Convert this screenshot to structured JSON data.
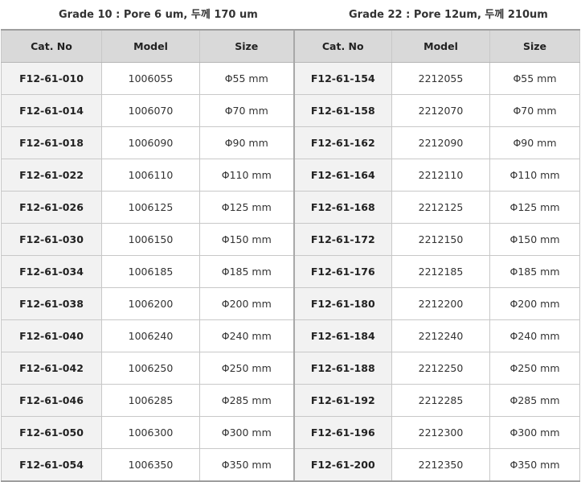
{
  "headings": {
    "left": "Grade 10 : Pore 6 um, 두께 170 um",
    "right": "Grade 22 : Pore 12um, 두께 210um"
  },
  "columns": {
    "cat_no": "Cat. No",
    "model": "Model",
    "size": "Size"
  },
  "rows": [
    {
      "left": {
        "cat": "F12-61-010",
        "model": "1006055",
        "size": "Φ55 mm"
      },
      "right": {
        "cat": "F12-61-154",
        "model": "2212055",
        "size": "Φ55 mm"
      }
    },
    {
      "left": {
        "cat": "F12-61-014",
        "model": "1006070",
        "size": "Φ70 mm"
      },
      "right": {
        "cat": "F12-61-158",
        "model": "2212070",
        "size": "Φ70 mm"
      }
    },
    {
      "left": {
        "cat": "F12-61-018",
        "model": "1006090",
        "size": "Φ90 mm"
      },
      "right": {
        "cat": "F12-61-162",
        "model": "2212090",
        "size": "Φ90 mm"
      }
    },
    {
      "left": {
        "cat": "F12-61-022",
        "model": "1006110",
        "size": "Φ110 mm"
      },
      "right": {
        "cat": "F12-61-164",
        "model": "2212110",
        "size": "Φ110 mm"
      }
    },
    {
      "left": {
        "cat": "F12-61-026",
        "model": "1006125",
        "size": "Φ125 mm"
      },
      "right": {
        "cat": "F12-61-168",
        "model": "2212125",
        "size": "Φ125 mm"
      }
    },
    {
      "left": {
        "cat": "F12-61-030",
        "model": "1006150",
        "size": "Φ150 mm"
      },
      "right": {
        "cat": "F12-61-172",
        "model": "2212150",
        "size": "Φ150 mm"
      }
    },
    {
      "left": {
        "cat": "F12-61-034",
        "model": "1006185",
        "size": "Φ185 mm"
      },
      "right": {
        "cat": "F12-61-176",
        "model": "2212185",
        "size": "Φ185 mm"
      }
    },
    {
      "left": {
        "cat": "F12-61-038",
        "model": "1006200",
        "size": "Φ200 mm"
      },
      "right": {
        "cat": "F12-61-180",
        "model": "2212200",
        "size": "Φ200 mm"
      }
    },
    {
      "left": {
        "cat": "F12-61-040",
        "model": "1006240",
        "size": "Φ240 mm"
      },
      "right": {
        "cat": "F12-61-184",
        "model": "2212240",
        "size": "Φ240 mm"
      }
    },
    {
      "left": {
        "cat": "F12-61-042",
        "model": "1006250",
        "size": "Φ250 mm"
      },
      "right": {
        "cat": "F12-61-188",
        "model": "2212250",
        "size": "Φ250 mm"
      }
    },
    {
      "left": {
        "cat": "F12-61-046",
        "model": "1006285",
        "size": "Φ285 mm"
      },
      "right": {
        "cat": "F12-61-192",
        "model": "2212285",
        "size": "Φ285 mm"
      }
    },
    {
      "left": {
        "cat": "F12-61-050",
        "model": "1006300",
        "size": "Φ300 mm"
      },
      "right": {
        "cat": "F12-61-196",
        "model": "2212300",
        "size": "Φ300 mm"
      }
    },
    {
      "left": {
        "cat": "F12-61-054",
        "model": "1006350",
        "size": "Φ350 mm"
      },
      "right": {
        "cat": "F12-61-200",
        "model": "2212350",
        "size": "Φ350 mm"
      }
    }
  ],
  "colors": {
    "header_bg": "#d9d9d9",
    "cat_cell_bg": "#f2f2f2",
    "border": "#c8c8c8"
  }
}
